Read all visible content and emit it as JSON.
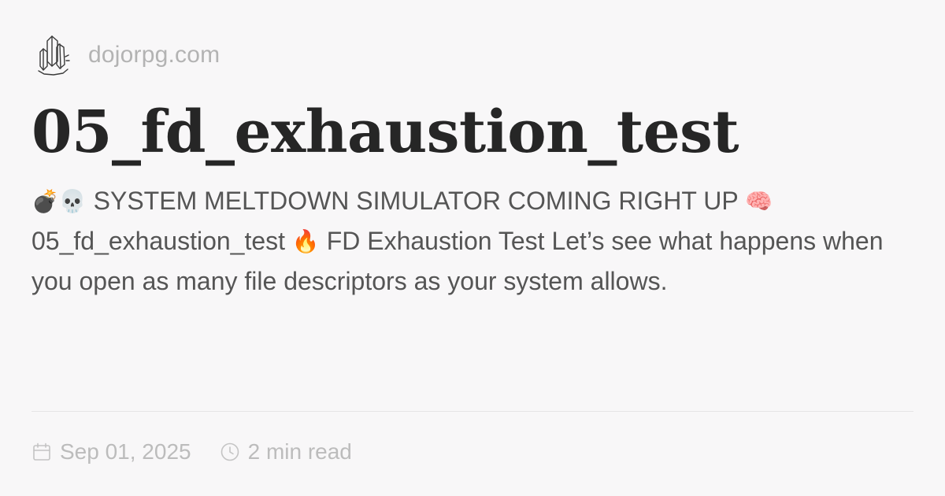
{
  "site": {
    "name": "dojorpg.com",
    "logo_icon": "crystal-cluster-icon"
  },
  "post": {
    "title": "05_fd_exhaustion_test",
    "description": {
      "emoji_bomb": "💣",
      "emoji_skull": "💀",
      "text_1": "SYSTEM MELTDOWN SIMULATOR COMING RIGHT UP",
      "emoji_brain": "🧠",
      "text_2": "05_fd_exhaustion_test",
      "emoji_fire": "🔥",
      "text_3": "FD Exhaustion Test Let’s see what happens when you open as many file descriptors as your system allows."
    },
    "date": "Sep 01, 2025",
    "date_icon": "calendar-icon",
    "read_time": "2 min read",
    "read_time_icon": "clock-icon"
  },
  "colors": {
    "background": "#f8f7f8",
    "title": "#262626",
    "body_text": "#555555",
    "muted": "#bcbcbc",
    "divider": "#e6e5e6"
  }
}
